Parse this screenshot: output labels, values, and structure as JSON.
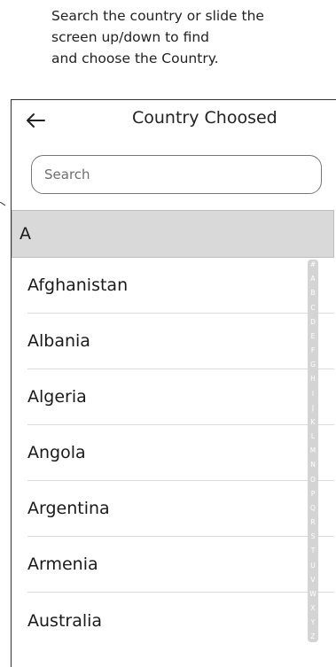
{
  "instruction": {
    "lines": [
      "Search the country or slide the",
      "screen up/down to find",
      "and choose the Country."
    ]
  },
  "header": {
    "title": "Country Choosed",
    "back_icon": "arrow-left-icon"
  },
  "search": {
    "placeholder": "Search",
    "value": ""
  },
  "section": {
    "letter": "A"
  },
  "countries": [
    "Afghanistan",
    "Albania",
    "Algeria",
    "Angola",
    "Argentina",
    "Armenia",
    "Australia"
  ],
  "index_letters": [
    "#",
    "A",
    "B",
    "C",
    "D",
    "E",
    "F",
    "G",
    "H",
    "I",
    "J",
    "K",
    "L",
    "M",
    "N",
    "O",
    "P",
    "Q",
    "R",
    "S",
    "T",
    "U",
    "V",
    "W",
    "X",
    "Y",
    "Z"
  ],
  "colors": {
    "section_bg": "#d9d9d9",
    "index_bg": "#d4d4d4",
    "divider": "#dcdcdc"
  }
}
